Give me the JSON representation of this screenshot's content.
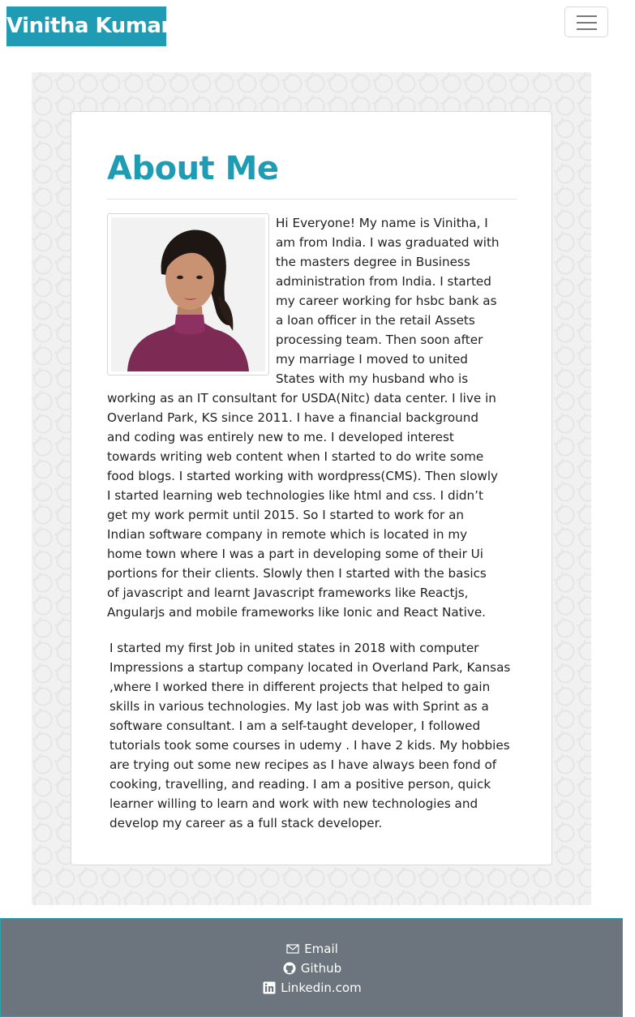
{
  "navbar": {
    "brand": "Vinitha Kumar",
    "toggler_icon": "hamburger-menu-icon"
  },
  "about": {
    "title": "About Me",
    "photo_alt": "profile-photo",
    "paragraph1": "Hi Everyone! My name is Vinitha, I am from India. I was graduated with the masters degree in Business administration from India. I started my career working for hsbc bank as a loan officer in the retail Assets processing team. Then soon after my marriage I moved to united States with my husband who is working as an IT consultant for USDA(Nitc) data center. I live in Overland Park, KS since 2011. I have a financial background and coding was entirely new to me. I developed interest towards writing web content when I started to do write some food blogs. I started working with wordpress(CMS). Then slowly I started learning web technologies like html and css. I didn’t get my work permit until 2015. So I started to work for an Indian software company in remote which is located in my home town where I was a part in developing some of their Ui portions for their clients. Slowly then I started with the basics of javascript and learnt Javascript frameworks like Reactjs, Angularjs and mobile frameworks like Ionic and React Native.",
    "paragraph2": "I started my first Job in united states in 2018 with computer Impressions a startup company located in Overland Park, Kansas ,where I worked there in different projects that helped to gain skills in various technologies. My last job was with Sprint as a software consultant. I am a self-taught developer, I followed tutorials took some courses in udemy . I have 2 kids. My hobbies are trying out some new recipes as I have always been fond of cooking, travelling, and reading. I am a positive person, quick learner willing to learn and work with new technologies and develop my career as a full stack developer."
  },
  "footer": {
    "links": [
      {
        "label": "Email",
        "icon": "envelope-icon"
      },
      {
        "label": "Github",
        "icon": "github-icon"
      },
      {
        "label": "Linkedin.com",
        "icon": "linkedin-icon"
      }
    ]
  },
  "colors": {
    "accent": "#1f9cb3",
    "footer_bg": "#6c757d",
    "text": "#222222"
  }
}
